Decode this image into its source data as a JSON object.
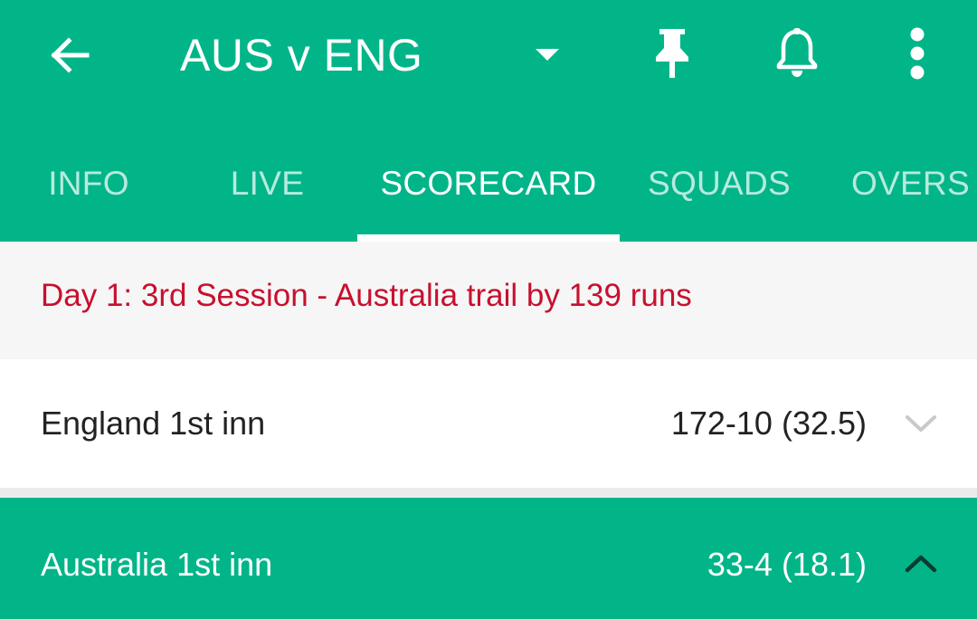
{
  "header": {
    "title": "AUS v ENG",
    "colors": {
      "primary": "#02b589",
      "on_primary": "#ffffff"
    },
    "icons": [
      "back-arrow-icon",
      "dropdown-arrow-icon",
      "pin-icon",
      "bell-icon",
      "more-vert-icon"
    ]
  },
  "tabs": [
    {
      "label": "INFO",
      "active": false
    },
    {
      "label": "LIVE",
      "active": false
    },
    {
      "label": "SCORECARD",
      "active": true
    },
    {
      "label": "SQUADS",
      "active": false
    },
    {
      "label": "OVERS",
      "active": false
    }
  ],
  "status": {
    "text": "Day 1: 3rd Session - Australia trail by 139 runs",
    "color": "#c8102e"
  },
  "innings": [
    {
      "label": "England 1st inn",
      "score": "172-10 (32.5)",
      "expanded": false,
      "icon": "chevron-down-icon"
    },
    {
      "label": "Australia 1st inn",
      "score": "33-4 (18.1)",
      "expanded": true,
      "icon": "chevron-up-icon"
    }
  ]
}
